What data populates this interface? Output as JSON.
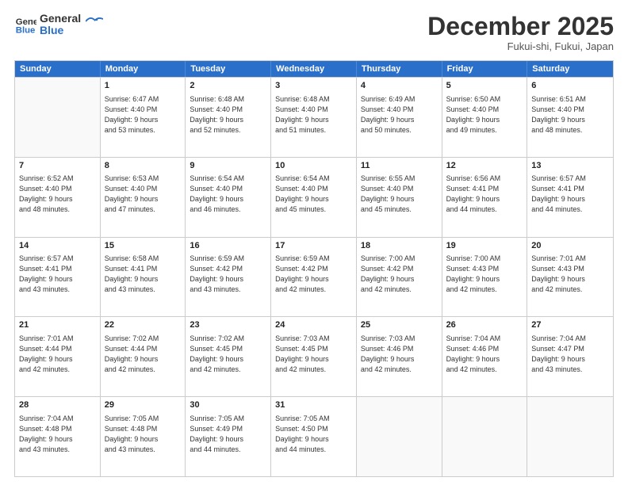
{
  "header": {
    "logo_line1": "General",
    "logo_line2": "Blue",
    "month": "December 2025",
    "location": "Fukui-shi, Fukui, Japan"
  },
  "weekdays": [
    "Sunday",
    "Monday",
    "Tuesday",
    "Wednesday",
    "Thursday",
    "Friday",
    "Saturday"
  ],
  "rows": [
    [
      {
        "day": "",
        "lines": []
      },
      {
        "day": "1",
        "lines": [
          "Sunrise: 6:47 AM",
          "Sunset: 4:40 PM",
          "Daylight: 9 hours",
          "and 53 minutes."
        ]
      },
      {
        "day": "2",
        "lines": [
          "Sunrise: 6:48 AM",
          "Sunset: 4:40 PM",
          "Daylight: 9 hours",
          "and 52 minutes."
        ]
      },
      {
        "day": "3",
        "lines": [
          "Sunrise: 6:48 AM",
          "Sunset: 4:40 PM",
          "Daylight: 9 hours",
          "and 51 minutes."
        ]
      },
      {
        "day": "4",
        "lines": [
          "Sunrise: 6:49 AM",
          "Sunset: 4:40 PM",
          "Daylight: 9 hours",
          "and 50 minutes."
        ]
      },
      {
        "day": "5",
        "lines": [
          "Sunrise: 6:50 AM",
          "Sunset: 4:40 PM",
          "Daylight: 9 hours",
          "and 49 minutes."
        ]
      },
      {
        "day": "6",
        "lines": [
          "Sunrise: 6:51 AM",
          "Sunset: 4:40 PM",
          "Daylight: 9 hours",
          "and 48 minutes."
        ]
      }
    ],
    [
      {
        "day": "7",
        "lines": [
          "Sunrise: 6:52 AM",
          "Sunset: 4:40 PM",
          "Daylight: 9 hours",
          "and 48 minutes."
        ]
      },
      {
        "day": "8",
        "lines": [
          "Sunrise: 6:53 AM",
          "Sunset: 4:40 PM",
          "Daylight: 9 hours",
          "and 47 minutes."
        ]
      },
      {
        "day": "9",
        "lines": [
          "Sunrise: 6:54 AM",
          "Sunset: 4:40 PM",
          "Daylight: 9 hours",
          "and 46 minutes."
        ]
      },
      {
        "day": "10",
        "lines": [
          "Sunrise: 6:54 AM",
          "Sunset: 4:40 PM",
          "Daylight: 9 hours",
          "and 45 minutes."
        ]
      },
      {
        "day": "11",
        "lines": [
          "Sunrise: 6:55 AM",
          "Sunset: 4:40 PM",
          "Daylight: 9 hours",
          "and 45 minutes."
        ]
      },
      {
        "day": "12",
        "lines": [
          "Sunrise: 6:56 AM",
          "Sunset: 4:41 PM",
          "Daylight: 9 hours",
          "and 44 minutes."
        ]
      },
      {
        "day": "13",
        "lines": [
          "Sunrise: 6:57 AM",
          "Sunset: 4:41 PM",
          "Daylight: 9 hours",
          "and 44 minutes."
        ]
      }
    ],
    [
      {
        "day": "14",
        "lines": [
          "Sunrise: 6:57 AM",
          "Sunset: 4:41 PM",
          "Daylight: 9 hours",
          "and 43 minutes."
        ]
      },
      {
        "day": "15",
        "lines": [
          "Sunrise: 6:58 AM",
          "Sunset: 4:41 PM",
          "Daylight: 9 hours",
          "and 43 minutes."
        ]
      },
      {
        "day": "16",
        "lines": [
          "Sunrise: 6:59 AM",
          "Sunset: 4:42 PM",
          "Daylight: 9 hours",
          "and 43 minutes."
        ]
      },
      {
        "day": "17",
        "lines": [
          "Sunrise: 6:59 AM",
          "Sunset: 4:42 PM",
          "Daylight: 9 hours",
          "and 42 minutes."
        ]
      },
      {
        "day": "18",
        "lines": [
          "Sunrise: 7:00 AM",
          "Sunset: 4:42 PM",
          "Daylight: 9 hours",
          "and 42 minutes."
        ]
      },
      {
        "day": "19",
        "lines": [
          "Sunrise: 7:00 AM",
          "Sunset: 4:43 PM",
          "Daylight: 9 hours",
          "and 42 minutes."
        ]
      },
      {
        "day": "20",
        "lines": [
          "Sunrise: 7:01 AM",
          "Sunset: 4:43 PM",
          "Daylight: 9 hours",
          "and 42 minutes."
        ]
      }
    ],
    [
      {
        "day": "21",
        "lines": [
          "Sunrise: 7:01 AM",
          "Sunset: 4:44 PM",
          "Daylight: 9 hours",
          "and 42 minutes."
        ]
      },
      {
        "day": "22",
        "lines": [
          "Sunrise: 7:02 AM",
          "Sunset: 4:44 PM",
          "Daylight: 9 hours",
          "and 42 minutes."
        ]
      },
      {
        "day": "23",
        "lines": [
          "Sunrise: 7:02 AM",
          "Sunset: 4:45 PM",
          "Daylight: 9 hours",
          "and 42 minutes."
        ]
      },
      {
        "day": "24",
        "lines": [
          "Sunrise: 7:03 AM",
          "Sunset: 4:45 PM",
          "Daylight: 9 hours",
          "and 42 minutes."
        ]
      },
      {
        "day": "25",
        "lines": [
          "Sunrise: 7:03 AM",
          "Sunset: 4:46 PM",
          "Daylight: 9 hours",
          "and 42 minutes."
        ]
      },
      {
        "day": "26",
        "lines": [
          "Sunrise: 7:04 AM",
          "Sunset: 4:46 PM",
          "Daylight: 9 hours",
          "and 42 minutes."
        ]
      },
      {
        "day": "27",
        "lines": [
          "Sunrise: 7:04 AM",
          "Sunset: 4:47 PM",
          "Daylight: 9 hours",
          "and 43 minutes."
        ]
      }
    ],
    [
      {
        "day": "28",
        "lines": [
          "Sunrise: 7:04 AM",
          "Sunset: 4:48 PM",
          "Daylight: 9 hours",
          "and 43 minutes."
        ]
      },
      {
        "day": "29",
        "lines": [
          "Sunrise: 7:05 AM",
          "Sunset: 4:48 PM",
          "Daylight: 9 hours",
          "and 43 minutes."
        ]
      },
      {
        "day": "30",
        "lines": [
          "Sunrise: 7:05 AM",
          "Sunset: 4:49 PM",
          "Daylight: 9 hours",
          "and 44 minutes."
        ]
      },
      {
        "day": "31",
        "lines": [
          "Sunrise: 7:05 AM",
          "Sunset: 4:50 PM",
          "Daylight: 9 hours",
          "and 44 minutes."
        ]
      },
      {
        "day": "",
        "lines": []
      },
      {
        "day": "",
        "lines": []
      },
      {
        "day": "",
        "lines": []
      }
    ]
  ]
}
